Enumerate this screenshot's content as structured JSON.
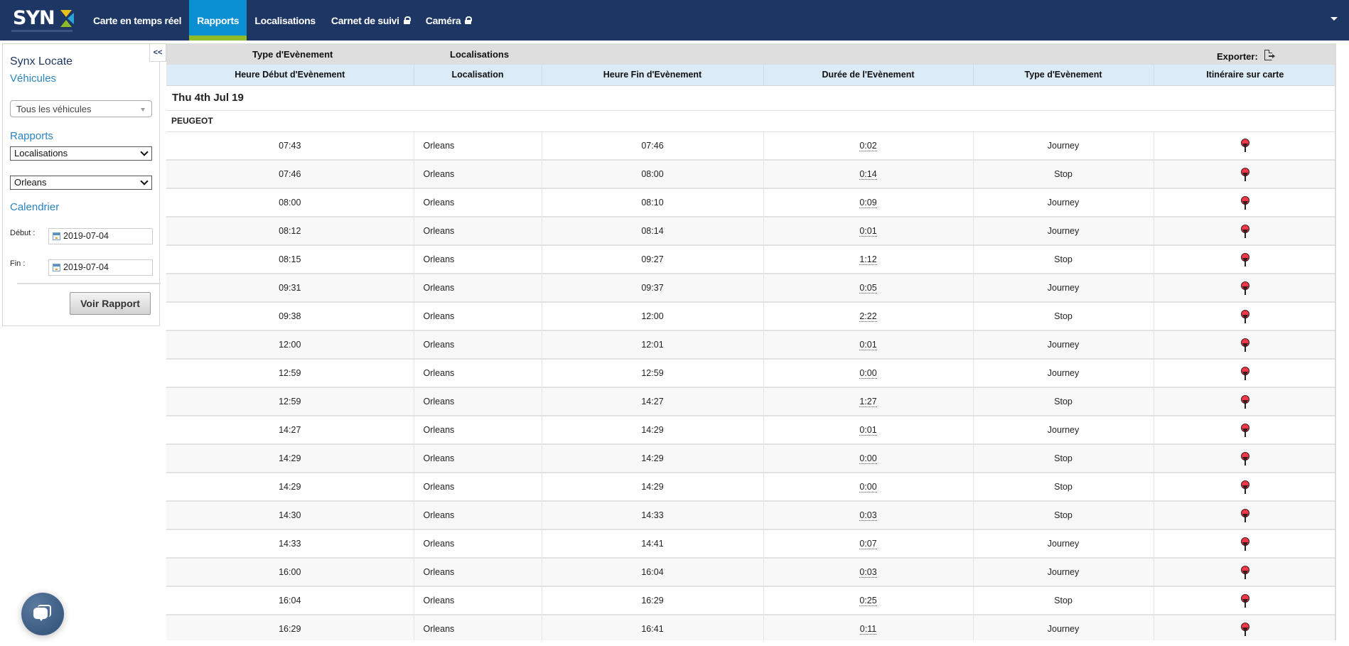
{
  "nav": {
    "logo_text": "SYN",
    "items": [
      {
        "label": "Carte en temps réel",
        "active": false,
        "locked": false
      },
      {
        "label": "Rapports",
        "active": true,
        "locked": false
      },
      {
        "label": "Localisations",
        "active": false,
        "locked": false
      },
      {
        "label": "Carnet de suivi",
        "active": false,
        "locked": true
      },
      {
        "label": "Caméra",
        "active": false,
        "locked": true
      }
    ],
    "colors": {
      "bar": "#1e3663",
      "active": "#0b8fd3",
      "active_underline": "#8fbc27"
    }
  },
  "sidebar": {
    "collapse_label": "<<",
    "title": "Synx Locate",
    "vehicles_heading": "Véhicules",
    "vehicles_select": "Tous les véhicules",
    "reports_heading": "Rapports",
    "report_type_select": "Localisations",
    "location_select": "Orleans",
    "calendar_heading": "Calendrier",
    "start_label": "Début :",
    "start_date": "2019-07-04",
    "end_label": "Fin :",
    "end_date": "2019-07-04",
    "submit_label": "Voir Rapport"
  },
  "report": {
    "toolbar": {
      "event_type_label": "Type d'Evènement",
      "locations_label": "Localisations",
      "export_label": "Exporter:"
    },
    "columns": [
      "Heure Début d'Evènement",
      "Localisation",
      "Heure Fin d'Evènement",
      "Durée de l'Evènement",
      "Type d'Evènement",
      "Itinéraire sur carte"
    ],
    "date": "Thu 4th Jul 19",
    "vehicle": "PEUGEOT",
    "rows": [
      {
        "start": "07:43",
        "location": "Orleans",
        "end": "07:46",
        "duration": "0:02",
        "type": "Journey"
      },
      {
        "start": "07:46",
        "location": "Orleans",
        "end": "08:00",
        "duration": "0:14",
        "type": "Stop"
      },
      {
        "start": "08:00",
        "location": "Orleans",
        "end": "08:10",
        "duration": "0:09",
        "type": "Journey"
      },
      {
        "start": "08:12",
        "location": "Orleans",
        "end": "08:14",
        "duration": "0:01",
        "type": "Journey"
      },
      {
        "start": "08:15",
        "location": "Orleans",
        "end": "09:27",
        "duration": "1:12",
        "type": "Stop"
      },
      {
        "start": "09:31",
        "location": "Orleans",
        "end": "09:37",
        "duration": "0:05",
        "type": "Journey"
      },
      {
        "start": "09:38",
        "location": "Orleans",
        "end": "12:00",
        "duration": "2:22",
        "type": "Stop"
      },
      {
        "start": "12:00",
        "location": "Orleans",
        "end": "12:01",
        "duration": "0:01",
        "type": "Journey"
      },
      {
        "start": "12:59",
        "location": "Orleans",
        "end": "12:59",
        "duration": "0:00",
        "type": "Journey"
      },
      {
        "start": "12:59",
        "location": "Orleans",
        "end": "14:27",
        "duration": "1:27",
        "type": "Stop"
      },
      {
        "start": "14:27",
        "location": "Orleans",
        "end": "14:29",
        "duration": "0:01",
        "type": "Journey"
      },
      {
        "start": "14:29",
        "location": "Orleans",
        "end": "14:29",
        "duration": "0:00",
        "type": "Stop"
      },
      {
        "start": "14:29",
        "location": "Orleans",
        "end": "14:29",
        "duration": "0:00",
        "type": "Stop"
      },
      {
        "start": "14:30",
        "location": "Orleans",
        "end": "14:33",
        "duration": "0:03",
        "type": "Stop"
      },
      {
        "start": "14:33",
        "location": "Orleans",
        "end": "14:41",
        "duration": "0:07",
        "type": "Journey"
      },
      {
        "start": "16:00",
        "location": "Orleans",
        "end": "16:04",
        "duration": "0:03",
        "type": "Journey"
      },
      {
        "start": "16:04",
        "location": "Orleans",
        "end": "16:29",
        "duration": "0:25",
        "type": "Stop"
      },
      {
        "start": "16:29",
        "location": "Orleans",
        "end": "16:41",
        "duration": "0:11",
        "type": "Journey"
      }
    ],
    "map_icon": "map-pin-icon",
    "colors": {
      "header_bg": "#dcebf8",
      "toolbar_bg": "#dedede",
      "pin": "#f2374a"
    }
  },
  "chat": {
    "icon": "chat-bubble-icon"
  }
}
